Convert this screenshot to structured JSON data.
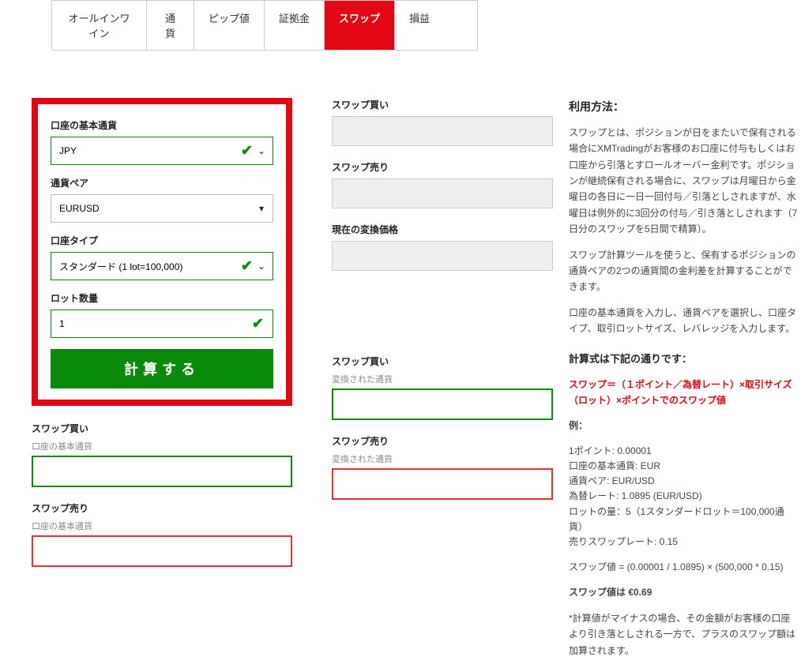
{
  "tabs": {
    "all_in_one": "オールインワイン",
    "currency": "通貨",
    "pip": "ピップ値",
    "margin": "証拠金",
    "swap": "スワップ",
    "profit_loss": "損益"
  },
  "form": {
    "base_currency_label": "口座の基本通貨",
    "base_currency_value": "JPY",
    "pair_label": "通貨ペア",
    "pair_value": "EURUSD",
    "account_type_label": "口座タイプ",
    "account_type_value": "スタンダード (1 lot=100,000)",
    "lot_label": "ロット数量",
    "lot_value": "1",
    "calc_button": "計算する"
  },
  "mid": {
    "swap_buy_label": "スワップ買い",
    "swap_sell_label": "スワップ売り",
    "rate_label": "現在の変換価格"
  },
  "results": {
    "swap_buy_label": "スワップ買い",
    "swap_sell_label": "スワップ売り",
    "sub_base": "口座の基本通貨",
    "sub_converted": "変換された通貨"
  },
  "help": {
    "title": "利用方法：",
    "p1": "スワップとは、ポジションが日をまたいで保有される場合にXMTradingがお客様のお口座に付与もしくはお口座から引落とすロールオーバー金利です。ポジションが継続保有される場合に、スワップは月曜日から金曜日の各日に一日一回付与／引落としされますが、水曜日は例外的に3回分の付与／引き落としされます（7日分のスワップを5日間で精算）。",
    "p2": "スワップ計算ツールを使うと、保有するポジションの通貨ペアの2つの通貨間の金利差を計算することができます。",
    "p3": "口座の基本通貨を入力し、通貨ペアを選択し、口座タイプ、取引ロットサイズ、レバレッジを入力します。",
    "formula_title": "計算式は下記の通りです：",
    "formula": "スワップ＝（１ポイント／為替レート）×取引サイズ（ロット）×ポイントでのスワップ値",
    "example_title": "例：",
    "ex1": "1ポイント: 0.00001",
    "ex2": "口座の基本通貨: EUR",
    "ex3": "通貨ペア: EUR/USD",
    "ex4": "為替レート: 1.0895 (EUR/USD)",
    "ex5": "ロットの量：5（1スタンダードロット＝100,000通貨）",
    "ex6": "売りスワップレート: 0.15",
    "ex7": "スワップ値 = (0.00001 / 1.0895) × (500,000 * 0.15)",
    "ex8": "スワップ値は €0.69",
    "note": "*計算値がマイナスの場合、その金額がお客様の口座より引き落としされる一方で、プラスのスワップ額は加算されます。"
  }
}
